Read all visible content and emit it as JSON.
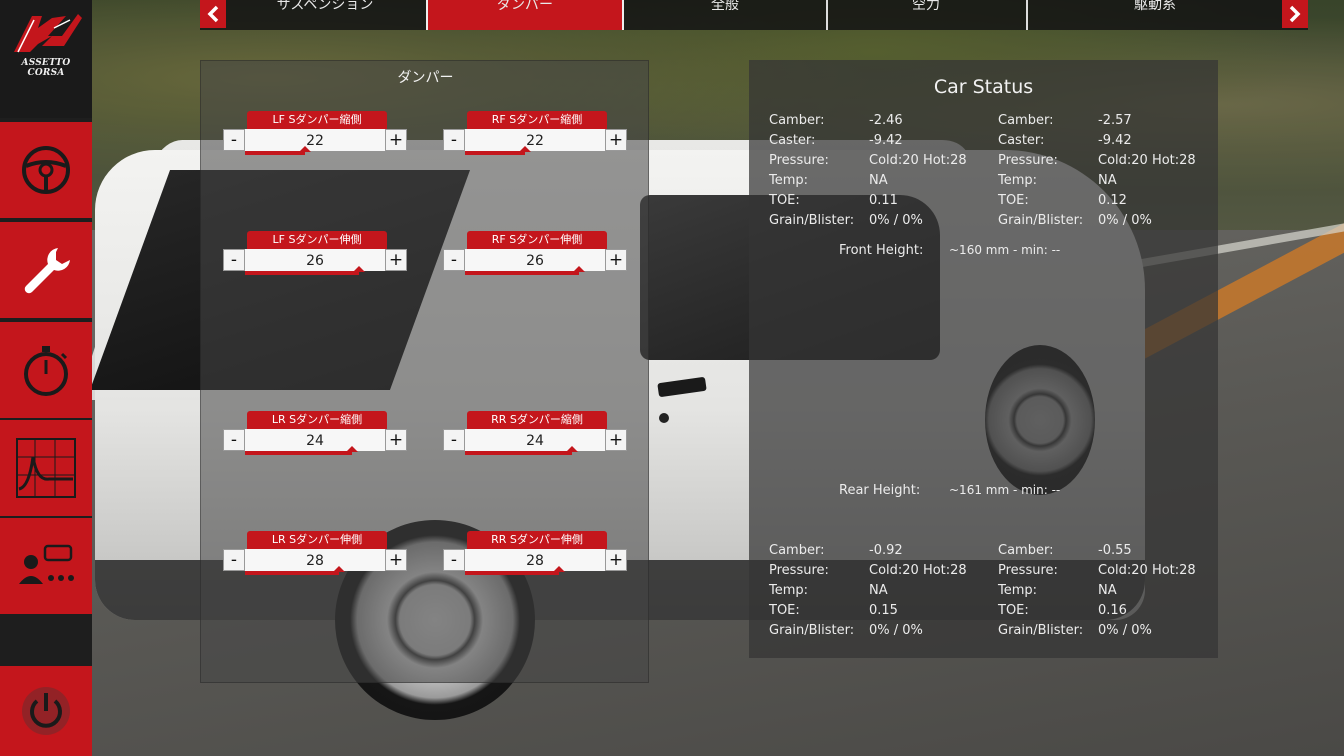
{
  "app": {
    "logo_text": "ASSETTO CORSA"
  },
  "tabs": [
    {
      "label": "サスペンション"
    },
    {
      "label": "ダンパー"
    },
    {
      "label": "全般"
    },
    {
      "label": "空力"
    },
    {
      "label": "駆動系"
    }
  ],
  "active_tab": "ダンパー",
  "sidebar": {
    "icons": [
      "steering-wheel-icon",
      "wrench-icon",
      "stopwatch-icon",
      "telemetry-chart-icon",
      "driver-settings-icon",
      "power-icon"
    ]
  },
  "damper": {
    "title": "ダンパー",
    "controls": [
      {
        "label": "LF  Sダンパー縮側",
        "value": "22",
        "level": 0.45
      },
      {
        "label": "RF  Sダンパー縮側",
        "value": "22",
        "level": 0.45
      },
      {
        "label": "LF  Sダンパー伸側",
        "value": "26",
        "level": 0.85
      },
      {
        "label": "RF  Sダンパー伸側",
        "value": "26",
        "level": 0.85
      },
      {
        "label": "LR  Sダンパー縮側",
        "value": "24",
        "level": 0.8
      },
      {
        "label": "RR  Sダンパー縮側",
        "value": "24",
        "level": 0.8
      },
      {
        "label": "LR  Sダンパー伸側",
        "value": "28",
        "level": 0.7
      },
      {
        "label": "RR  Sダンパー伸側",
        "value": "28",
        "level": 0.7
      }
    ],
    "minus": "-",
    "plus": "+"
  },
  "status": {
    "title": "Car Status",
    "front_left": [
      {
        "k": "Camber:",
        "v": "-2.46"
      },
      {
        "k": "Caster:",
        "v": "-9.42"
      },
      {
        "k": "Pressure:",
        "v": "Cold:20 Hot:28"
      },
      {
        "k": "Temp:",
        "v": "NA"
      },
      {
        "k": "TOE:",
        "v": "0.11"
      },
      {
        "k": "Grain/Blister:",
        "v": "0% / 0%"
      }
    ],
    "front_right": [
      {
        "k": "Camber:",
        "v": "-2.57"
      },
      {
        "k": "Caster:",
        "v": "-9.42"
      },
      {
        "k": "Pressure:",
        "v": "Cold:20 Hot:28"
      },
      {
        "k": "Temp:",
        "v": "NA"
      },
      {
        "k": "TOE:",
        "v": "0.12"
      },
      {
        "k": "Grain/Blister:",
        "v": "0% / 0%"
      }
    ],
    "front_height": {
      "label": "Front Height:",
      "value": "~160 mm - min: --"
    },
    "rear_height": {
      "label": "Rear Height:",
      "value": "~161 mm - min: --"
    },
    "rear_left": [
      {
        "k": "Camber:",
        "v": "-0.92"
      },
      {
        "k": "Pressure:",
        "v": "Cold:20 Hot:28"
      },
      {
        "k": "Temp:",
        "v": "NA"
      },
      {
        "k": "TOE:",
        "v": "0.15"
      },
      {
        "k": "Grain/Blister:",
        "v": "0% / 0%"
      }
    ],
    "rear_right": [
      {
        "k": "Camber:",
        "v": "-0.55"
      },
      {
        "k": "Pressure:",
        "v": "Cold:20 Hot:28"
      },
      {
        "k": "Temp:",
        "v": "NA"
      },
      {
        "k": "TOE:",
        "v": "0.16"
      },
      {
        "k": "Grain/Blister:",
        "v": "0% / 0%"
      }
    ]
  },
  "colors": {
    "accent": "#c4161c",
    "panel": "#464646"
  }
}
